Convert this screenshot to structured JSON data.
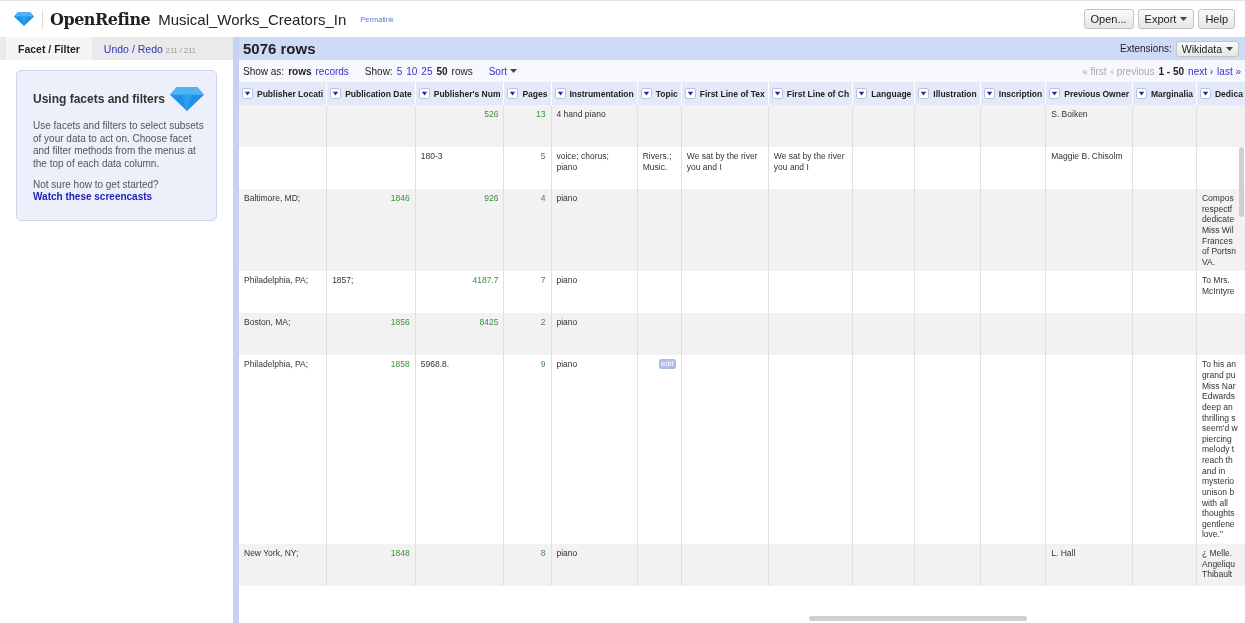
{
  "header": {
    "app_name": "OpenRefine",
    "project_name": "Musical_Works_Creators_In",
    "permalink": "Permalink",
    "buttons": [
      {
        "label": "Open...",
        "dropdown": false
      },
      {
        "label": "Export",
        "dropdown": true
      },
      {
        "label": "Help",
        "dropdown": false
      }
    ]
  },
  "left_panel": {
    "tabs": [
      {
        "label": "Facet / Filter",
        "selected": true
      },
      {
        "label": "Undo / Redo",
        "count": "211 / 211",
        "selected": false
      }
    ],
    "card": {
      "title": "Using facets and filters",
      "body": "Use facets and filters to select subsets of your data to act on. Choose facet and filter methods from the menus at the top of each data column.",
      "question": "Not sure how to get started?",
      "link": "Watch these screencasts"
    }
  },
  "data_panel": {
    "row_count": "5076 rows",
    "extensions_label": "Extensions:",
    "extensions_button": "Wikidata",
    "show_as_label": "Show as:",
    "show_as": [
      {
        "label": "rows",
        "selected": true
      },
      {
        "label": "records",
        "selected": false
      }
    ],
    "show_label": "Show:",
    "page_sizes": [
      {
        "label": "5",
        "selected": false
      },
      {
        "label": "10",
        "selected": false
      },
      {
        "label": "25",
        "selected": false
      },
      {
        "label": "50",
        "selected": true
      }
    ],
    "page_size_unit": "rows",
    "sort": "Sort",
    "pager": {
      "first": "« first",
      "previous": "‹ previous",
      "range": "1 - 50",
      "next": "next ›",
      "last": "last »",
      "first_disabled": true
    },
    "table": {
      "columns": [
        "Publisher Locati",
        "Publication Date",
        "Publisher's Num",
        "Pages",
        "Instrumentation",
        "Topic",
        "First Line of Tex",
        "First Line of Ch",
        "Language",
        "Illustration",
        "Inscription",
        "Previous Owner",
        "Marginalia",
        "Dedica"
      ],
      "rows": [
        {
          "cells": [
            {
              "kind": "empty"
            },
            {
              "kind": "empty"
            },
            {
              "kind": "number",
              "text": "526"
            },
            {
              "kind": "number",
              "text": "13"
            },
            {
              "kind": "text",
              "text": "4 hand piano"
            },
            {
              "kind": "empty"
            },
            {
              "kind": "empty"
            },
            {
              "kind": "empty"
            },
            {
              "kind": "empty"
            },
            {
              "kind": "empty"
            },
            {
              "kind": "empty"
            },
            {
              "kind": "text",
              "text": "S. Boiken"
            },
            {
              "kind": "empty"
            },
            {
              "kind": "empty"
            }
          ]
        },
        {
          "cells": [
            {
              "kind": "empty"
            },
            {
              "kind": "empty"
            },
            {
              "kind": "text",
              "text": "180-3"
            },
            {
              "kind": "number",
              "text": "5"
            },
            {
              "kind": "text",
              "text": "voice; chorus; piano"
            },
            {
              "kind": "text",
              "text": "Rivers.; Music."
            },
            {
              "kind": "text",
              "text": "We sat by the river you and I"
            },
            {
              "kind": "text",
              "text": "We sat by the river you and I"
            },
            {
              "kind": "empty"
            },
            {
              "kind": "empty"
            },
            {
              "kind": "empty"
            },
            {
              "kind": "text",
              "text": "Maggie B. Chisolm"
            },
            {
              "kind": "empty"
            },
            {
              "kind": "empty"
            }
          ]
        },
        {
          "cells": [
            {
              "kind": "text",
              "text": "Baltimore, MD;"
            },
            {
              "kind": "number",
              "text": "1846"
            },
            {
              "kind": "number",
              "text": "926"
            },
            {
              "kind": "number",
              "text": "4"
            },
            {
              "kind": "text",
              "text": "piano"
            },
            {
              "kind": "empty"
            },
            {
              "kind": "empty"
            },
            {
              "kind": "empty"
            },
            {
              "kind": "empty"
            },
            {
              "kind": "empty"
            },
            {
              "kind": "empty"
            },
            {
              "kind": "empty"
            },
            {
              "kind": "empty"
            },
            {
              "kind": "text",
              "text": "Compos\nrespectf\ndedicate\nMiss Wil\nFrances\nof Portsn\nVA."
            }
          ]
        },
        {
          "cells": [
            {
              "kind": "text",
              "text": "Philadelphia, PA;"
            },
            {
              "kind": "text",
              "text": "1857;"
            },
            {
              "kind": "number",
              "text": "4187.7"
            },
            {
              "kind": "number",
              "text": "7"
            },
            {
              "kind": "text",
              "text": "piano"
            },
            {
              "kind": "empty"
            },
            {
              "kind": "empty"
            },
            {
              "kind": "empty"
            },
            {
              "kind": "empty"
            },
            {
              "kind": "empty"
            },
            {
              "kind": "empty"
            },
            {
              "kind": "empty"
            },
            {
              "kind": "empty"
            },
            {
              "kind": "text",
              "text": "To Mrs.\nMcIntyre"
            }
          ]
        },
        {
          "cells": [
            {
              "kind": "text",
              "text": "Boston, MA;"
            },
            {
              "kind": "number",
              "text": "1856"
            },
            {
              "kind": "number",
              "text": "8425"
            },
            {
              "kind": "number",
              "text": "2"
            },
            {
              "kind": "text",
              "text": "piano"
            },
            {
              "kind": "empty"
            },
            {
              "kind": "empty"
            },
            {
              "kind": "empty"
            },
            {
              "kind": "empty"
            },
            {
              "kind": "empty"
            },
            {
              "kind": "empty"
            },
            {
              "kind": "empty"
            },
            {
              "kind": "empty"
            },
            {
              "kind": "empty"
            }
          ]
        },
        {
          "cells": [
            {
              "kind": "text",
              "text": "Philadelphia, PA;"
            },
            {
              "kind": "number",
              "text": "1858"
            },
            {
              "kind": "text",
              "text": "5968.8."
            },
            {
              "kind": "number",
              "text": "9"
            },
            {
              "kind": "text",
              "text": "piano"
            },
            {
              "kind": "edit",
              "text": "edit"
            },
            {
              "kind": "empty"
            },
            {
              "kind": "empty"
            },
            {
              "kind": "empty"
            },
            {
              "kind": "empty"
            },
            {
              "kind": "empty"
            },
            {
              "kind": "empty"
            },
            {
              "kind": "empty"
            },
            {
              "kind": "text",
              "text": "To his an\ngrand pu\nMiss Nar\nEdwards\ndeep an\nthrilling s\nseem'd w\npiercing\nmelody t\nreach th\nand in\nmysterio\nunison b\nwith all\nthoughts\ngentlene\nlove.\""
            }
          ]
        },
        {
          "cells": [
            {
              "kind": "text",
              "text": "New York, NY;"
            },
            {
              "kind": "number",
              "text": "1848"
            },
            {
              "kind": "empty"
            },
            {
              "kind": "number",
              "text": "8"
            },
            {
              "kind": "text",
              "text": "piano"
            },
            {
              "kind": "empty"
            },
            {
              "kind": "empty"
            },
            {
              "kind": "empty"
            },
            {
              "kind": "empty"
            },
            {
              "kind": "empty"
            },
            {
              "kind": "empty"
            },
            {
              "kind": "text",
              "text": "L. Hall"
            },
            {
              "kind": "empty"
            },
            {
              "kind": "text",
              "text": "¿ Melle.\nAngeliqu\nThibault"
            }
          ]
        }
      ]
    }
  }
}
